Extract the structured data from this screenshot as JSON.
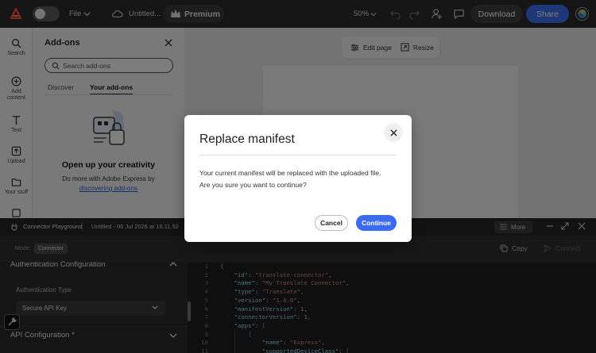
{
  "topbar": {
    "file_label": "File",
    "doc_title": "Untitled...",
    "premium_label": "Premium",
    "zoom": "50%",
    "download_label": "Download",
    "share_label": "Share",
    "accent_color": "#3a6ff0"
  },
  "rail": {
    "items": [
      {
        "label": "Search",
        "icon": "search-icon"
      },
      {
        "label": "Add content",
        "icon": "plus-circle-icon"
      },
      {
        "label": "Text",
        "icon": "text-icon"
      },
      {
        "label": "Upload",
        "icon": "upload-icon"
      },
      {
        "label": "Your stuff",
        "icon": "folder-icon"
      }
    ]
  },
  "addons": {
    "title": "Add-ons",
    "search_placeholder": "Search add-ons",
    "tabs": [
      "Discover",
      "Your add-ons"
    ],
    "active_tab": "Your add-ons",
    "promo_title": "Open up your creativity",
    "promo_text": "Do more with Adobe Express by",
    "promo_link": "discovering add-ons"
  },
  "canvas": {
    "edit_page_label": "Edit page",
    "resize_label": "Resize"
  },
  "connector": {
    "title": "Connector Playground",
    "file_info": "Untitled - 06 Jul 2026 at 16.11.52",
    "more_label": "More",
    "mode_label": "Mode:",
    "mode_value": "Connector",
    "copy_label": "Copy",
    "connect_label": "Connect",
    "sections": {
      "auth_title": "Authentication Configuration",
      "auth_type_label": "Authentication Type",
      "auth_type_value": "Secure API Key",
      "api_title": "API Configuration *"
    },
    "code_lines": [
      "1",
      "2",
      "3",
      "4",
      "5",
      "6",
      "7",
      "8",
      "9",
      "10",
      "11"
    ]
  },
  "modal": {
    "title": "Replace manifest",
    "body_line1": "Your current manifest will be replaced with the uploaded file.",
    "body_line2": "Are you sure you want to continue?",
    "cancel_label": "Cancel",
    "continue_label": "Continue"
  }
}
